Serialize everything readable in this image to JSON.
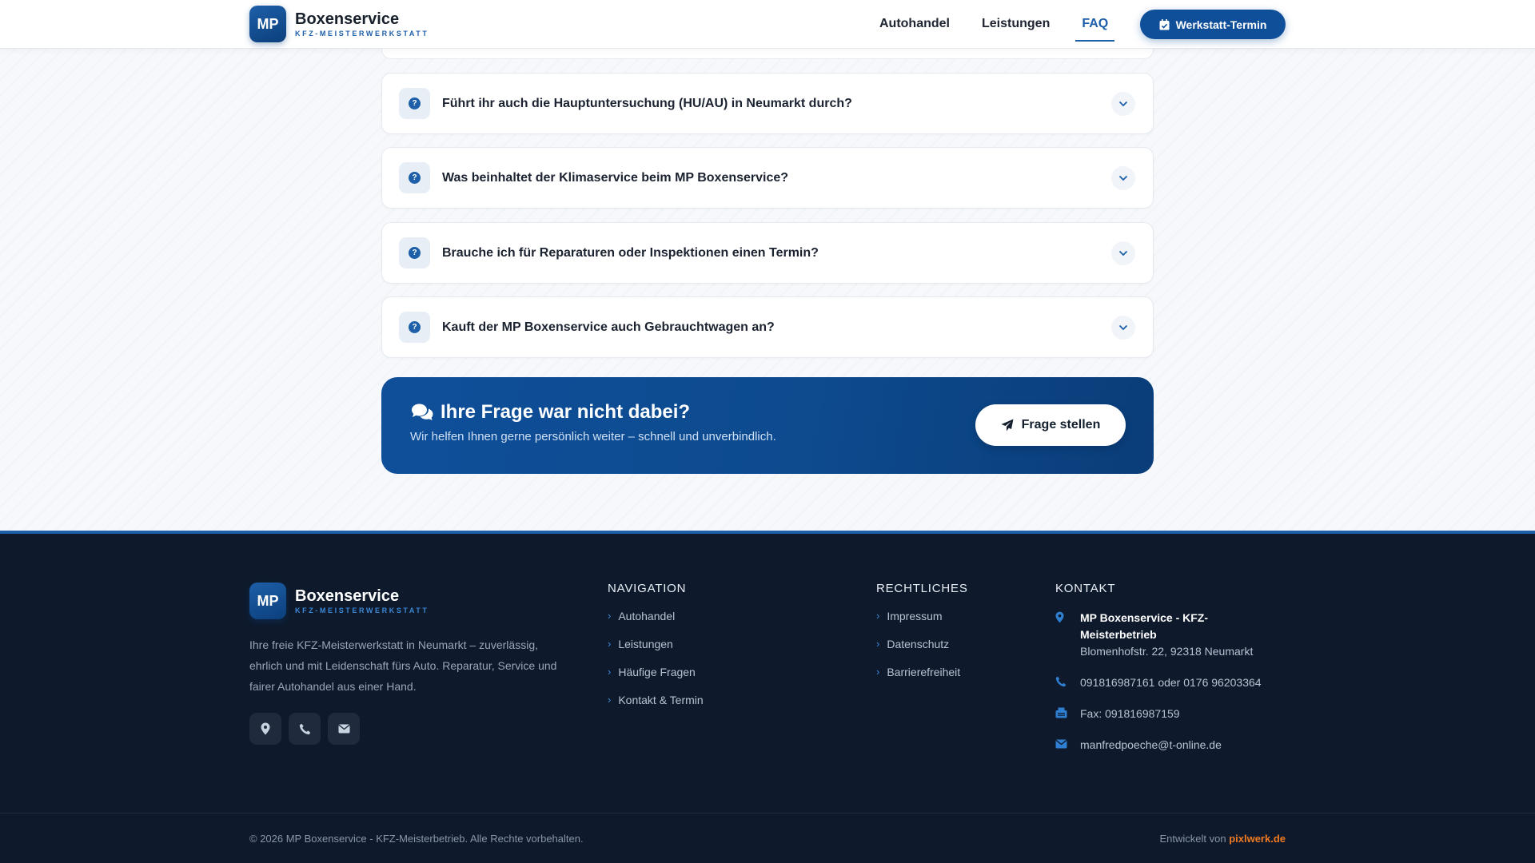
{
  "header": {
    "logo_initials": "MP",
    "brand_title": "Boxenservice",
    "brand_subtitle": "KFZ-MEISTERWERKSTATT",
    "nav": [
      {
        "label": "Autohandel",
        "active": false
      },
      {
        "label": "Leistungen",
        "active": false
      },
      {
        "label": "FAQ",
        "active": true
      }
    ],
    "cta_label": "Werkstatt-Termin"
  },
  "faq": {
    "items": [
      {
        "question": "Führt ihr auch die Hauptuntersuchung (HU/AU) in Neumarkt durch?"
      },
      {
        "question": "Was beinhaltet der Klimaservice beim MP Boxenservice?"
      },
      {
        "question": "Brauche ich für Reparaturen oder Inspektionen einen Termin?"
      },
      {
        "question": "Kauft der MP Boxenservice auch Gebrauchtwagen an?"
      }
    ],
    "icon_glyph": "?"
  },
  "banner": {
    "title": "Ihre Frage war nicht dabei?",
    "subtitle": "Wir helfen Ihnen gerne persönlich weiter – schnell und unverbindlich.",
    "button_label": "Frage stellen"
  },
  "footer": {
    "logo_initials": "MP",
    "brand_title": "Boxenservice",
    "brand_subtitle": "KFZ-MEISTERWERKSTATT",
    "description": "Ihre freie KFZ-Meisterwerkstatt in Neumarkt – zuverlässig, ehrlich und mit Leidenschaft fürs Auto. Reparatur, Service und fairer Autohandel aus einer Hand.",
    "navigation": {
      "heading": "NAVIGATION",
      "links": [
        "Autohandel",
        "Leistungen",
        "Häufige Fragen",
        "Kontakt & Termin"
      ]
    },
    "legal": {
      "heading": "RECHTLICHES",
      "links": [
        "Impressum",
        "Datenschutz",
        "Barrierefreiheit"
      ]
    },
    "contact": {
      "heading": "KONTAKT",
      "company": "MP Boxenservice - KFZ-Meisterbetrieb",
      "address": "Blomenhofstr. 22, 92318 Neumarkt",
      "phone": "091816987161 oder 0176 96203364",
      "fax": "Fax: 091816987159",
      "email": "manfredpoeche@t-online.de"
    },
    "copyright": "© 2026 MP Boxenservice - KFZ-Meisterbetrieb. Alle Rechte vorbehalten.",
    "developer_prefix": "Entwickelt von",
    "developer_name": "pixlwerk.de"
  },
  "colors": {
    "brand_blue": "#1d5fa8",
    "footer_bg": "#0e1a2c",
    "accent_orange": "#f07a22"
  },
  "icons": {
    "cta": "calendar-check-icon",
    "faq": "question-circle-icon",
    "toggle": "chevron-down-icon",
    "banner": "comments-icon",
    "banner_button": "paper-plane-icon",
    "social": [
      "map-pin-icon",
      "phone-icon",
      "envelope-icon"
    ],
    "contact": [
      "map-pin-icon",
      "phone-icon",
      "fax-icon",
      "envelope-icon"
    ]
  }
}
